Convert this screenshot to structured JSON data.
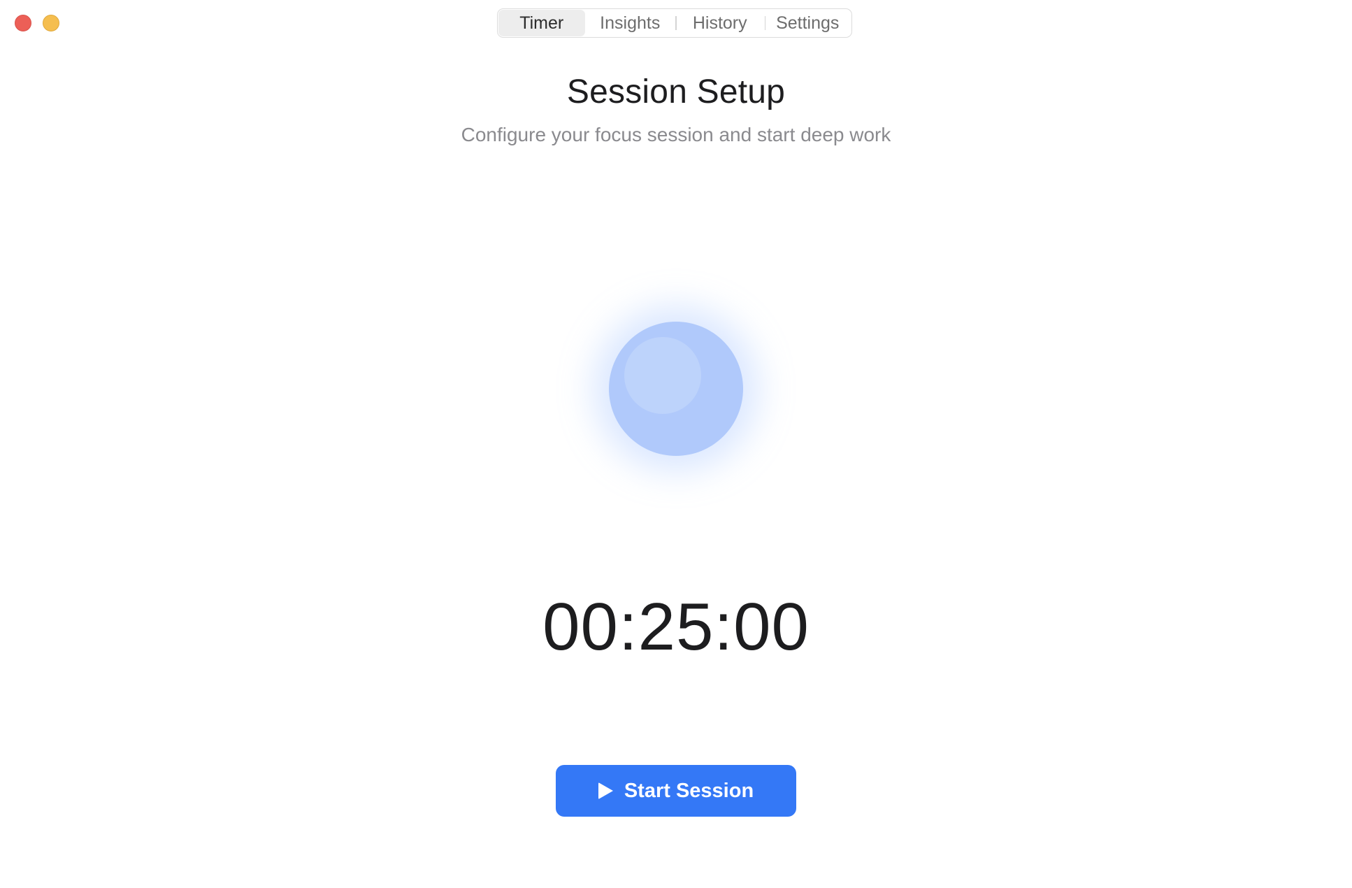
{
  "window": {
    "traffic_lights": [
      "close",
      "minimize"
    ]
  },
  "tabs": [
    {
      "label": "Timer",
      "active": true
    },
    {
      "label": "Insights",
      "active": false
    },
    {
      "label": "History",
      "active": false
    },
    {
      "label": "Settings",
      "active": false
    }
  ],
  "header": {
    "title": "Session Setup",
    "subtitle": "Configure your focus session and start deep work"
  },
  "orb": {
    "icon": "focus-orb",
    "color": "#b0c9fb"
  },
  "timer": {
    "display": "00:25:00"
  },
  "start_button": {
    "label": "Start Session",
    "icon": "play-icon",
    "color": "#3478f6"
  },
  "colors": {
    "close": "#ec5f57",
    "minimize": "#f5be4f",
    "accent": "#3478f6"
  }
}
